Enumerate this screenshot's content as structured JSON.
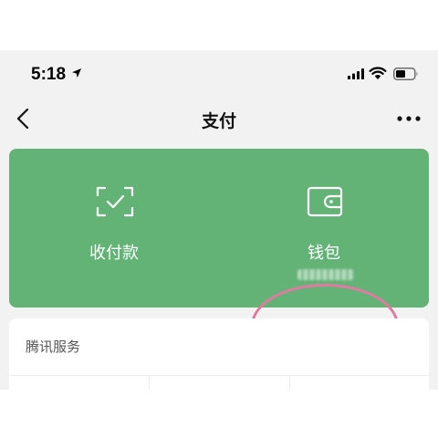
{
  "status_bar": {
    "time": "5:18"
  },
  "nav": {
    "title": "支付"
  },
  "payment_card": {
    "background_color": "#63b276",
    "actions": [
      {
        "label": "收付款",
        "icon": "scan-qr-icon"
      },
      {
        "label": "钱包",
        "icon": "wallet-icon"
      }
    ]
  },
  "services": {
    "title": "腾讯服务"
  }
}
